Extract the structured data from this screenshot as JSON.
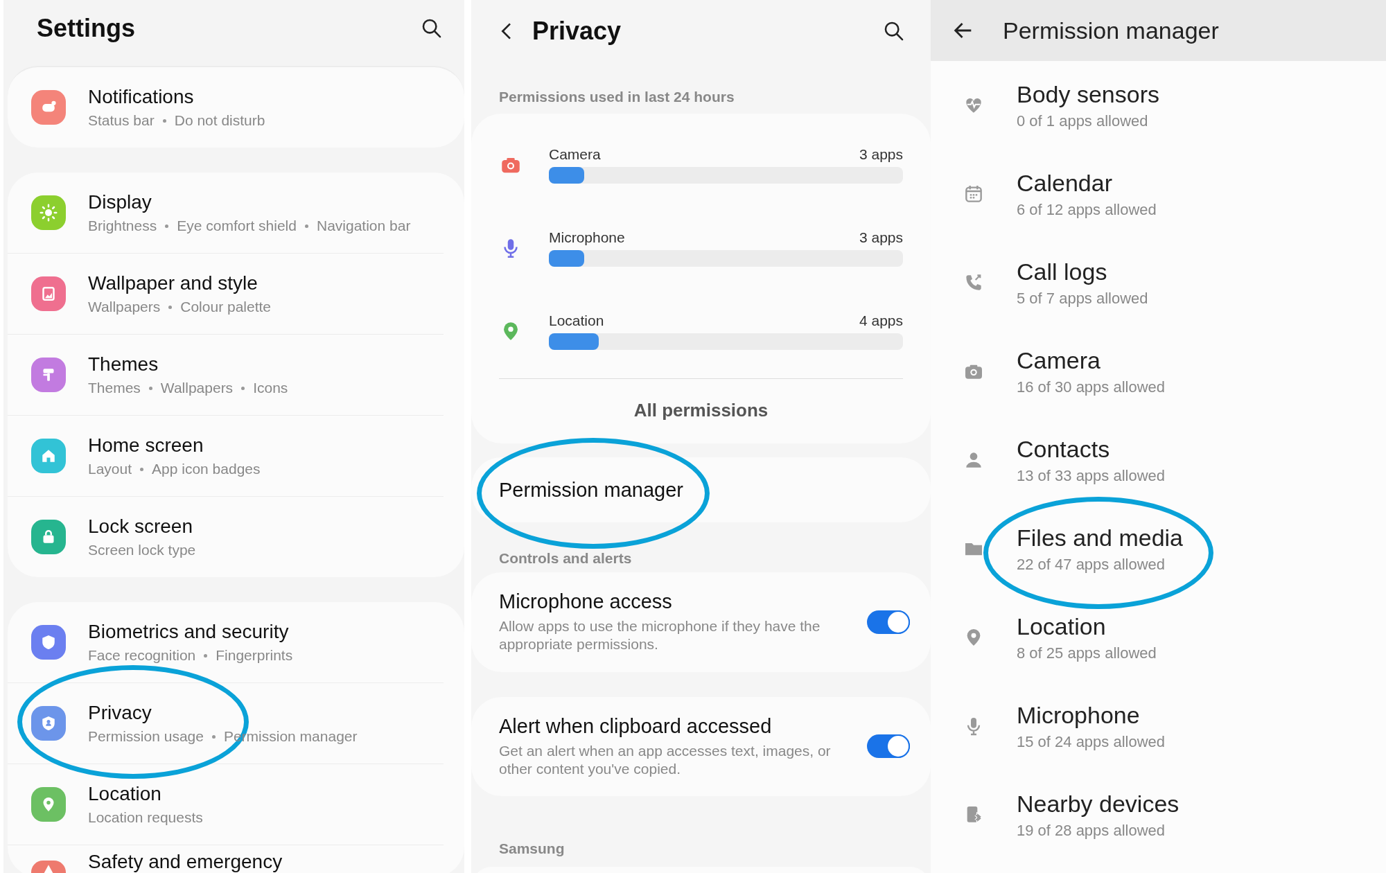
{
  "settings": {
    "title": "Settings",
    "groups": [
      [
        {
          "color": "#f4847a",
          "title": "Notifications",
          "parts": [
            "Status bar",
            "Do not disturb"
          ],
          "circled": false
        }
      ],
      [
        {
          "color": "#8ccf2e",
          "title": "Display",
          "parts": [
            "Brightness",
            "Eye comfort shield",
            "Navigation bar"
          ],
          "circled": false
        },
        {
          "color": "#ef6f8f",
          "title": "Wallpaper and style",
          "parts": [
            "Wallpapers",
            "Colour palette"
          ],
          "circled": false
        },
        {
          "color": "#c27be0",
          "title": "Themes",
          "parts": [
            "Themes",
            "Wallpapers",
            "Icons"
          ],
          "circled": false
        },
        {
          "color": "#32c3d6",
          "title": "Home screen",
          "parts": [
            "Layout",
            "App icon badges"
          ],
          "circled": false
        },
        {
          "color": "#26b58f",
          "title": "Lock screen",
          "parts": [
            "Screen lock type"
          ],
          "circled": false
        }
      ],
      [
        {
          "color": "#6b7ff0",
          "title": "Biometrics and security",
          "parts": [
            "Face recognition",
            "Fingerprints"
          ],
          "circled": false
        },
        {
          "color": "#6c95ea",
          "title": "Privacy",
          "parts": [
            "Permission usage",
            "Permission manager"
          ],
          "circled": true
        },
        {
          "color": "#6cc063",
          "title": "Location",
          "parts": [
            "Location requests"
          ],
          "circled": false
        },
        {
          "color": "#ee7a6e",
          "title": "Safety and emergency",
          "circled": false
        }
      ]
    ]
  },
  "privacy": {
    "title": "Privacy",
    "section": "Permissions used in last 24 hours",
    "usage": [
      {
        "color": "#ef6a5f",
        "name": "Camera",
        "count": "3 apps",
        "level": 0.1
      },
      {
        "color": "#6f6ee8",
        "name": "Microphone",
        "count": "3 apps",
        "level": 0.1
      },
      {
        "color": "#5cb85c",
        "name": "Location",
        "count": "4 apps",
        "level": 0.14
      }
    ],
    "all_link": "All permissions",
    "manager": {
      "label": "Permission manager",
      "circled": true
    },
    "controls_header": "Controls and alerts",
    "toggles": [
      {
        "title": "Microphone access",
        "desc": "Allow apps to use the microphone if they have the appropriate permissions.",
        "on": true
      },
      {
        "title": "Alert when clipboard accessed",
        "desc": "Get an alert when an app accesses text, images, or other content you've copied.",
        "on": true
      }
    ],
    "samsung_header": "Samsung"
  },
  "manager": {
    "title": "Permission manager",
    "items": [
      {
        "name": "Body sensors",
        "count": "0 of 1 apps allowed",
        "circled": false
      },
      {
        "name": "Calendar",
        "count": "6 of 12 apps allowed",
        "circled": false
      },
      {
        "name": "Call logs",
        "count": "5 of 7 apps allowed",
        "circled": false
      },
      {
        "name": "Camera",
        "count": "16 of 30 apps allowed",
        "circled": false
      },
      {
        "name": "Contacts",
        "count": "13 of 33 apps allowed",
        "circled": false
      },
      {
        "name": "Files and media",
        "count": "22 of 47 apps allowed",
        "circled": true
      },
      {
        "name": "Location",
        "count": "8 of 25 apps allowed",
        "circled": false
      },
      {
        "name": "Microphone",
        "count": "15 of 24 apps allowed",
        "circled": false
      },
      {
        "name": "Nearby devices",
        "count": "19 of 28 apps allowed",
        "circled": false
      }
    ]
  }
}
